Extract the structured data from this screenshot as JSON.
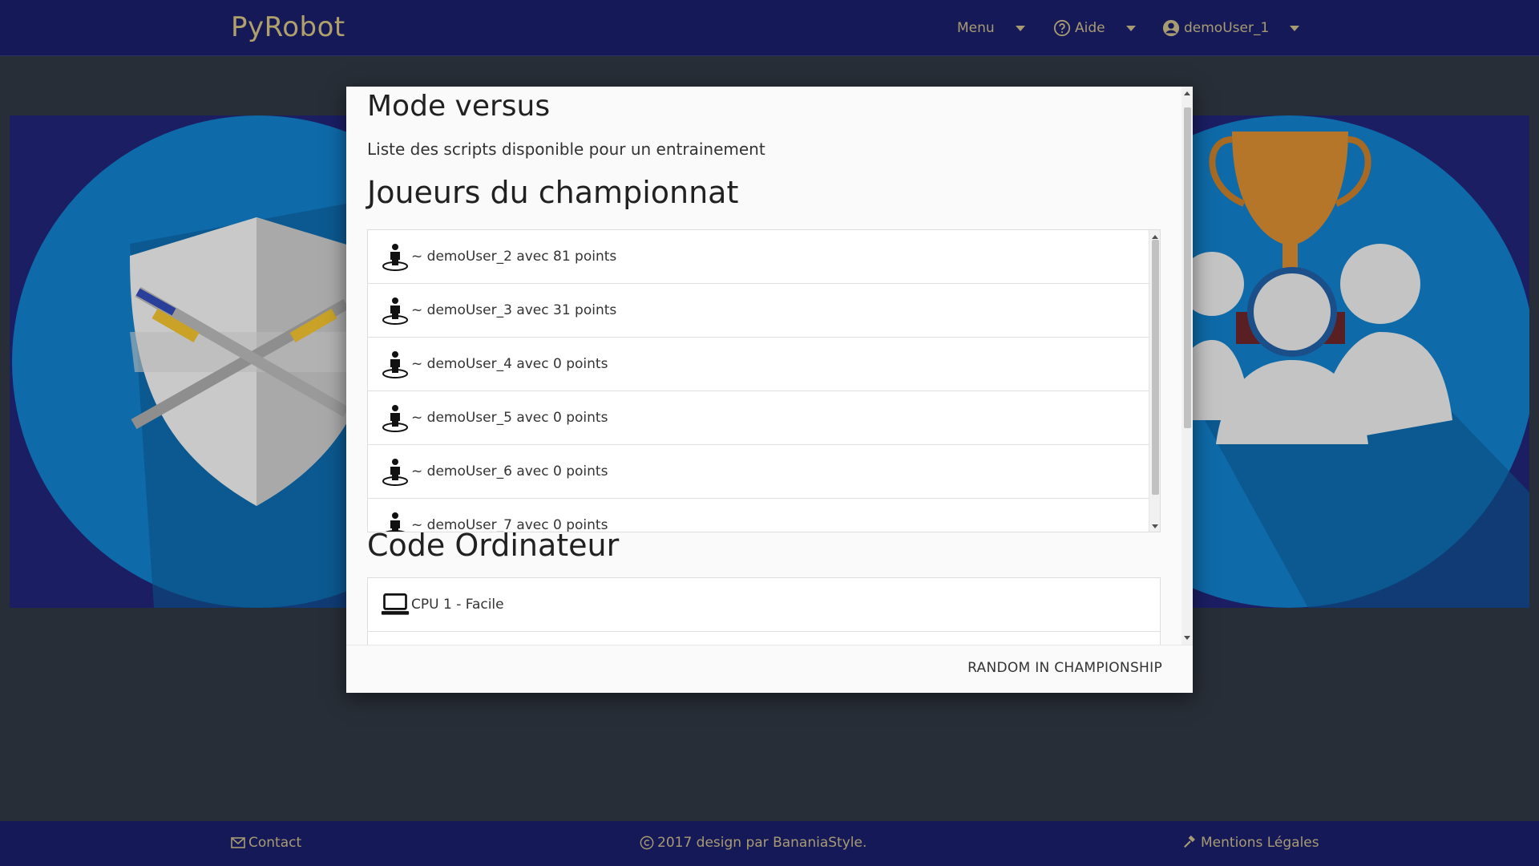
{
  "app": {
    "brand": "PyRobot"
  },
  "nav": {
    "menu_label": "Menu",
    "help_label": "Aide",
    "user_label": "demoUser_1"
  },
  "modal": {
    "title": "Mode versus",
    "subtitle": "Liste des scripts disponible pour un entrainement",
    "players_section_title": "Joueurs du championnat",
    "players": [
      {
        "label": "~ demoUser_2 avec 81 points",
        "icon": "player-icon"
      },
      {
        "label": "~ demoUser_3 avec 31 points",
        "icon": "player-icon"
      },
      {
        "label": "~ demoUser_4 avec 0 points",
        "icon": "player-icon"
      },
      {
        "label": "~ demoUser_5 avec 0 points",
        "icon": "player-icon"
      },
      {
        "label": "~ demoUser_6 avec 0 points",
        "icon": "player-icon"
      },
      {
        "label": "~ demoUser_7 avec 0 points",
        "icon": "player-icon"
      }
    ],
    "cpu_section_title": "Code Ordinateur",
    "cpu_items": [
      {
        "label": "CPU 1 - Facile",
        "icon": "laptop-icon"
      }
    ],
    "footer_button": "RANDOM IN CHAMPIONSHIP"
  },
  "footer": {
    "contact_label": "Contact",
    "copyright": "2017 design par BananiaStyle.",
    "legal_label": "Mentions Légales"
  },
  "colors": {
    "navbar_bg": "#151958",
    "nav_text": "#a89b72",
    "brand_text": "#b0a06a",
    "page_bg": "#282e37",
    "modal_bg": "#fafafa"
  }
}
